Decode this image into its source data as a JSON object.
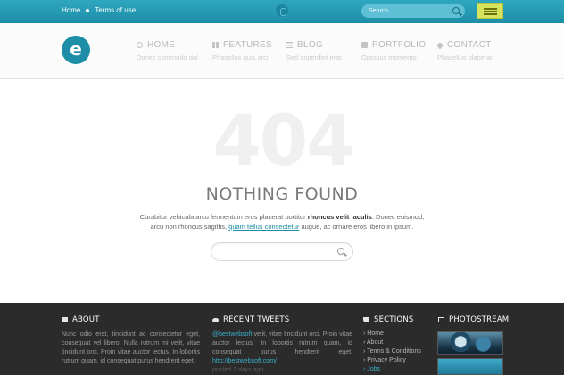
{
  "topbar": {
    "breadcrumbs": [
      "Home",
      "Terms of use"
    ],
    "search_placeholder": "Search"
  },
  "header": {
    "logo_letter": "e",
    "nav": [
      {
        "label": "HOME",
        "sub": "Donec commodo dui",
        "icon": "people-icon"
      },
      {
        "label": "FEATURES",
        "sub": "Phasellus quis orci",
        "icon": "grid-icon"
      },
      {
        "label": "BLOG",
        "sub": "Sed imperdiet erat",
        "icon": "list-icon"
      },
      {
        "label": "PORTFOLIO",
        "sub": "Optopus momento",
        "icon": "folder-icon"
      },
      {
        "label": "CONTACT",
        "sub": "Phasellus placerat",
        "icon": "map-pin-icon"
      }
    ]
  },
  "main": {
    "big_code": "404",
    "title": "NOTHING FOUND",
    "text_1": "Curabitur vehicula arcu fermentum eros placerat portitor ",
    "text_bold": "rhoncus velit iaculis",
    "text_2": ". Donec euismod, arcu non rhoncus sagittis, ",
    "text_link": "quam tellus consectetur",
    "text_3": " augue, ac ornare eros libero in ipsum.",
    "search_placeholder": ""
  },
  "footer": {
    "about": {
      "title": "ABOUT",
      "text": "Nunc odio erat, tincidunt ac consectetur eget, consequat vel libero. Nulla rutrum mi velit, vitae tincidunt orci. Proin vitae auctor lectus. In lobortis rutrum quam, id consequat purus hendrerit eget."
    },
    "tweets": {
      "title": "RECENT TWEETS",
      "handle": "@bestwebsoft",
      "text": " velit, vitae tincidunt orci. Proin vitae auctor lectus. In lobortis rutrum quam, id consequat purus hendrerit eget. ",
      "link": "http://bestwebsoft.com/",
      "time": "posted 2 days ago"
    },
    "sections": {
      "title": "SECTIONS",
      "items": [
        "Home",
        "About",
        "Terms & Conditions",
        "Privacy Policy",
        "Jobs"
      ]
    },
    "photostream": {
      "title": "PHOTOSTREAM"
    }
  },
  "colors": {
    "accent": "#1e8ea8",
    "menu_button": "#d6e35c",
    "footer_bg": "#2b2b2b"
  }
}
